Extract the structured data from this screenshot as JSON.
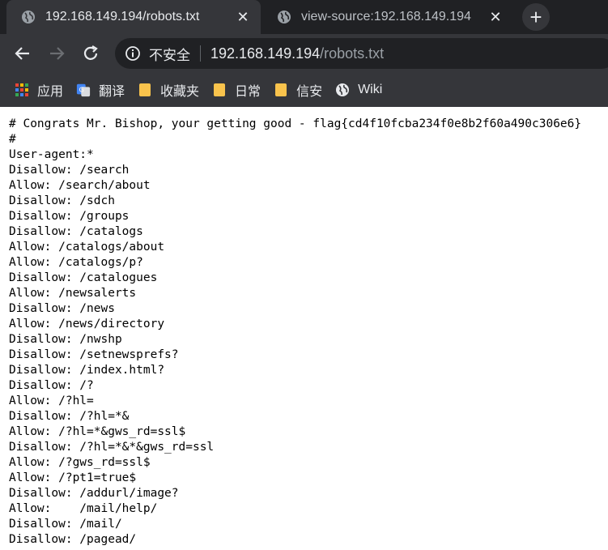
{
  "tabs": [
    {
      "title": "192.168.149.194/robots.txt",
      "active": true
    },
    {
      "title": "view-source:192.168.149.194",
      "active": false
    }
  ],
  "omnibox": {
    "security_label": "不安全",
    "url_host": "192.168.149.194",
    "url_path": "/robots.txt"
  },
  "bookmarks": [
    {
      "label": "应用",
      "icon": "apps-grid-icon"
    },
    {
      "label": "翻译",
      "icon": "google-translate-icon"
    },
    {
      "label": "收藏夹",
      "icon": "folder-icon"
    },
    {
      "label": "日常",
      "icon": "folder-icon"
    },
    {
      "label": "信安",
      "icon": "folder-icon"
    },
    {
      "label": "Wiki",
      "icon": "globe-icon"
    }
  ],
  "robots_lines": [
    "# Congrats Mr. Bishop, your getting good - flag{cd4f10fcba234f0e8b2f60a490c306e6}",
    "#",
    "User-agent:*",
    "Disallow: /search",
    "Allow: /search/about",
    "Disallow: /sdch",
    "Disallow: /groups",
    "Disallow: /catalogs",
    "Allow: /catalogs/about",
    "Allow: /catalogs/p?",
    "Disallow: /catalogues",
    "Allow: /newsalerts",
    "Disallow: /news",
    "Allow: /news/directory",
    "Disallow: /nwshp",
    "Disallow: /setnewsprefs?",
    "Disallow: /index.html?",
    "Disallow: /?",
    "Allow: /?hl=",
    "Disallow: /?hl=*&",
    "Allow: /?hl=*&gws_rd=ssl$",
    "Disallow: /?hl=*&*&gws_rd=ssl",
    "Allow: /?gws_rd=ssl$",
    "Allow: /?pt1=true$",
    "Disallow: /addurl/image?",
    "Allow:    /mail/help/",
    "Disallow: /mail/",
    "Disallow: /pagead/"
  ]
}
